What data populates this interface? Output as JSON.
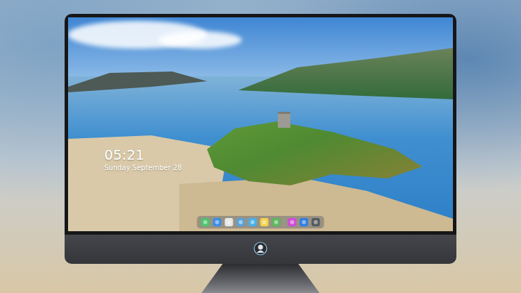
{
  "lock_screen": {
    "time": "05:21",
    "date": "Sunday September 28"
  },
  "dock": {
    "items": [
      {
        "kind": "app",
        "color": "#4cc46a"
      },
      {
        "kind": "app",
        "color": "#3a8ee6"
      },
      {
        "kind": "app",
        "color": "#e6e6e6"
      },
      {
        "kind": "app",
        "color": "#5aa0d8"
      },
      {
        "kind": "app",
        "color": "#47b0e8"
      },
      {
        "kind": "app",
        "color": "#f3d24a"
      },
      {
        "kind": "app",
        "color": "#5cb85c"
      },
      {
        "kind": "separator",
        "color": "#9aa0a8"
      },
      {
        "kind": "app",
        "color": "#d14bd6"
      },
      {
        "kind": "app",
        "color": "#2f7de1"
      },
      {
        "kind": "app",
        "color": "#555a60"
      }
    ]
  }
}
